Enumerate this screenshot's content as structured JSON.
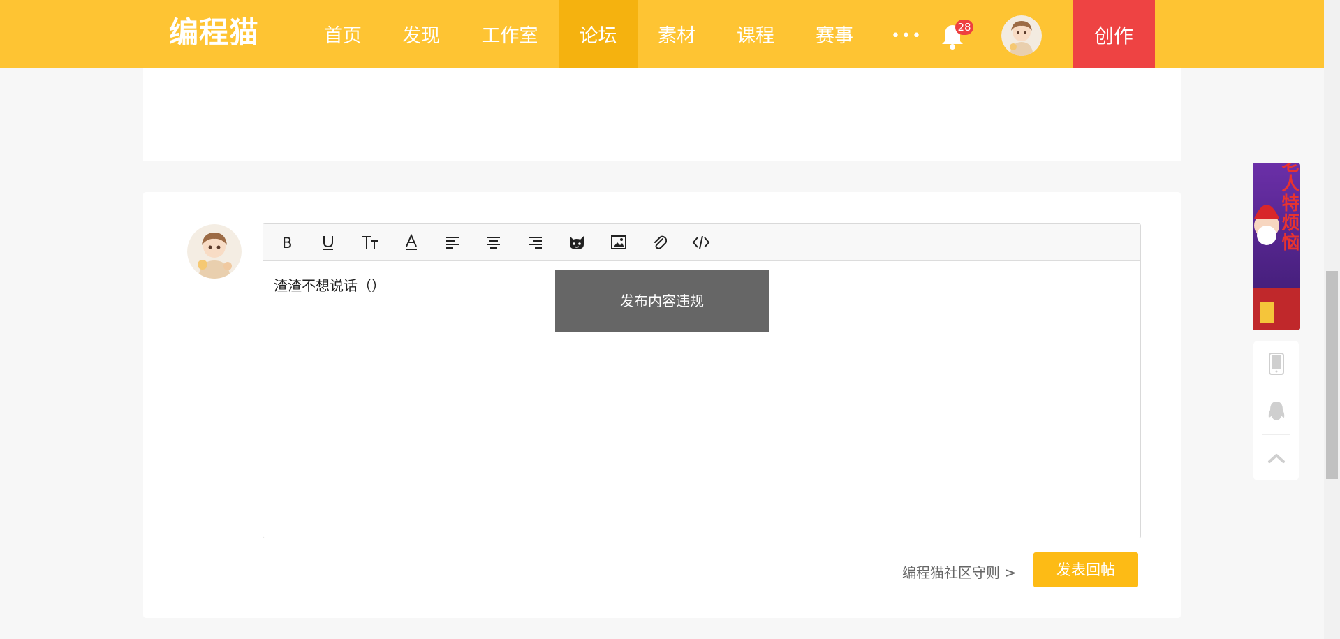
{
  "header": {
    "logo": "编程猫",
    "nav": [
      "首页",
      "发现",
      "工作室",
      "论坛",
      "素材",
      "课程",
      "赛事"
    ],
    "active_nav": "论坛",
    "more_label": "•••",
    "notification_count": "28",
    "create_label": "创作",
    "colors": {
      "header_bg": "#fec433",
      "active_bg": "#f5b20f",
      "create_bg": "#ee4343"
    }
  },
  "reply": {
    "toolbar_icons": [
      "bold-icon",
      "underline-icon",
      "font-size-icon",
      "font-color-icon",
      "align-left-icon",
      "align-center-icon",
      "align-right-icon",
      "emoji-cat-icon",
      "image-icon",
      "attachment-icon",
      "code-icon"
    ],
    "editor_text": "渣渣不想说话（）",
    "toast": "发布内容违规",
    "rules_link": "编程猫社区守则 >",
    "submit_label": "发表回帖"
  },
  "sidebar": {
    "banner_text": "圣诞老人特烦恼",
    "tools": [
      "phone-icon",
      "qq-penguin-icon",
      "back-to-top-icon"
    ]
  }
}
